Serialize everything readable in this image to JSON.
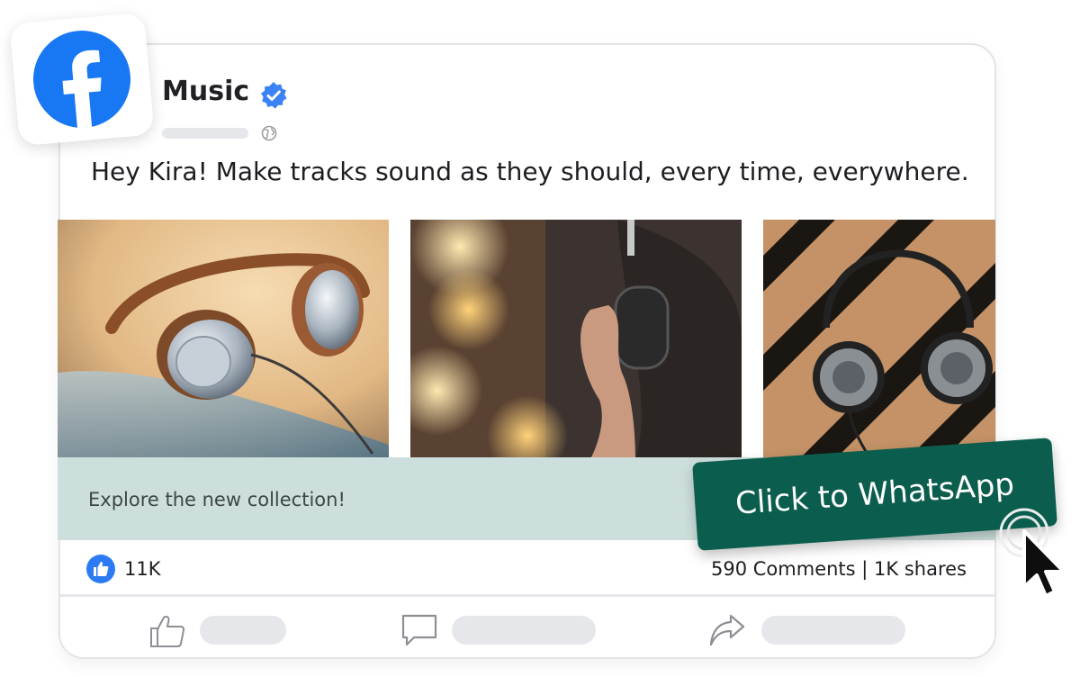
{
  "post": {
    "page_name": "Music",
    "text": "Hey Kira! Make tracks sound as they should, every time, everywhere.",
    "cta_text": "Explore the new collection!",
    "likes": "11K",
    "stats": "590 Comments | 1K shares"
  },
  "overlay": {
    "button_label": "Click to WhatsApp"
  },
  "colors": {
    "facebook_blue": "#1877f2",
    "whatsapp_green": "#0b5e4d",
    "cta_strip": "#cddfdc"
  },
  "icons": [
    "facebook-logo-icon",
    "verified-badge-icon",
    "globe-icon",
    "like-reaction-icon",
    "thumbs-up-icon",
    "comment-icon",
    "share-icon",
    "pointer-cursor-icon"
  ]
}
